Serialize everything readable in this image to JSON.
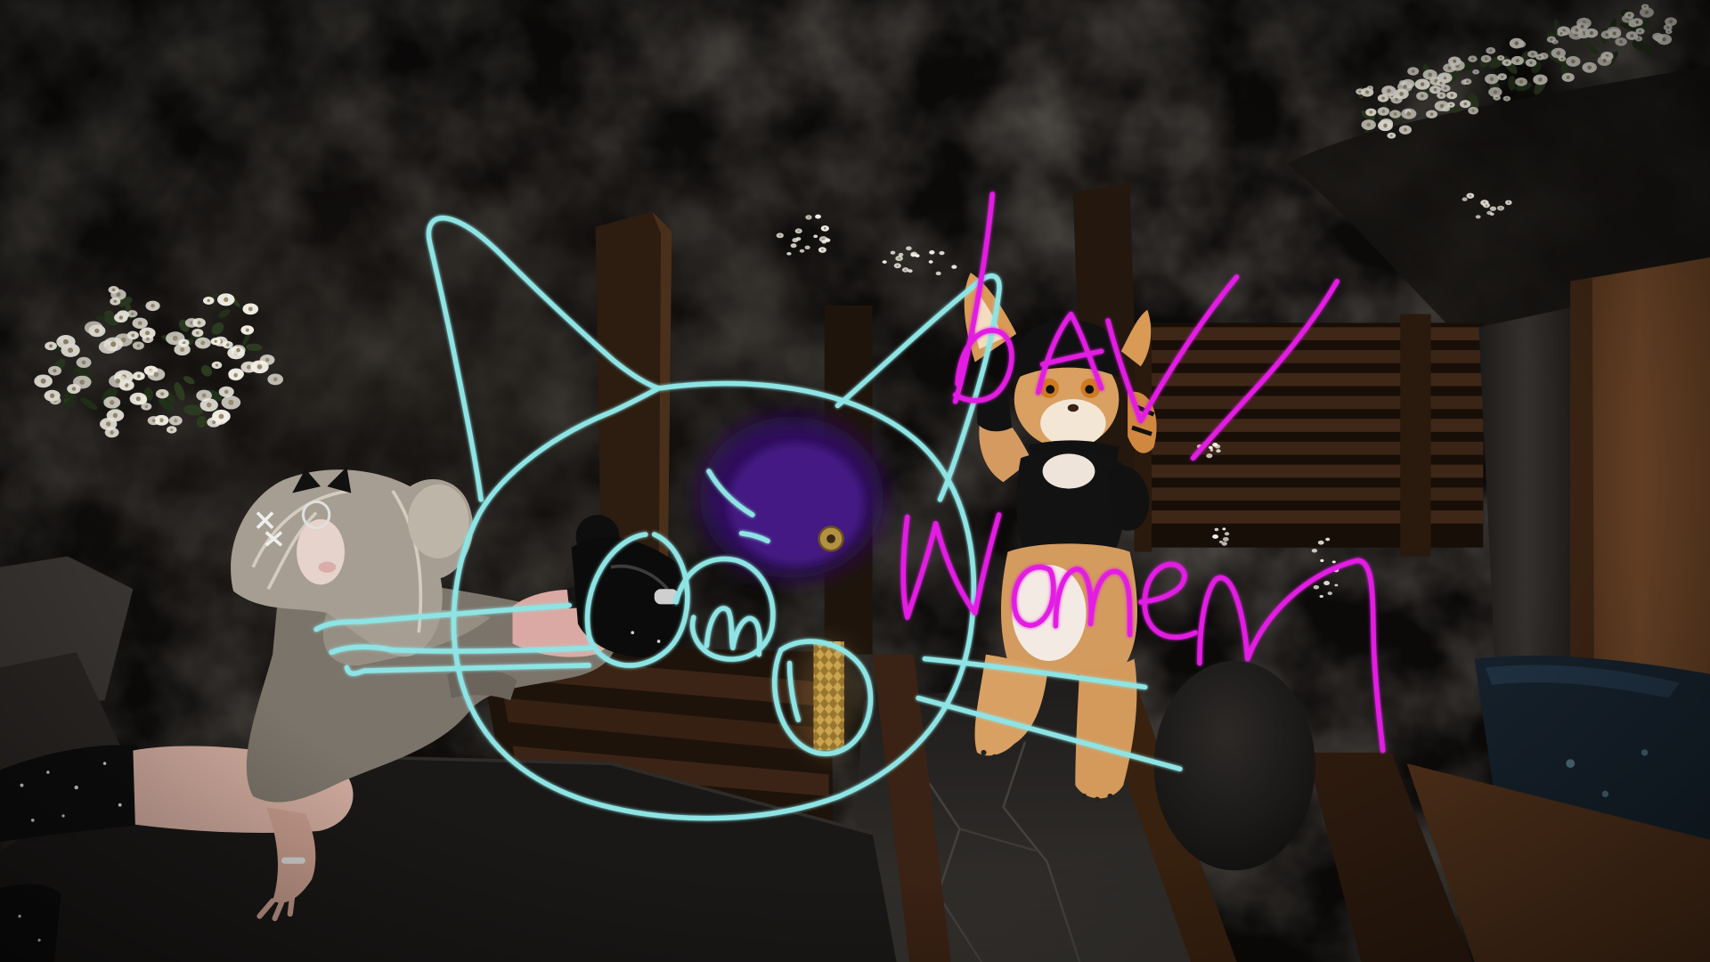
{
  "colors": {
    "background": "#0c0a09",
    "doodle_cyan": "#8ee4e4",
    "doodle_magenta": "#e31ee3",
    "wood": "#3b2415",
    "flower": "#f2efe6"
  },
  "doodles": {
    "handwriting": {
      "line1": "bAy",
      "line2": "women"
    }
  }
}
